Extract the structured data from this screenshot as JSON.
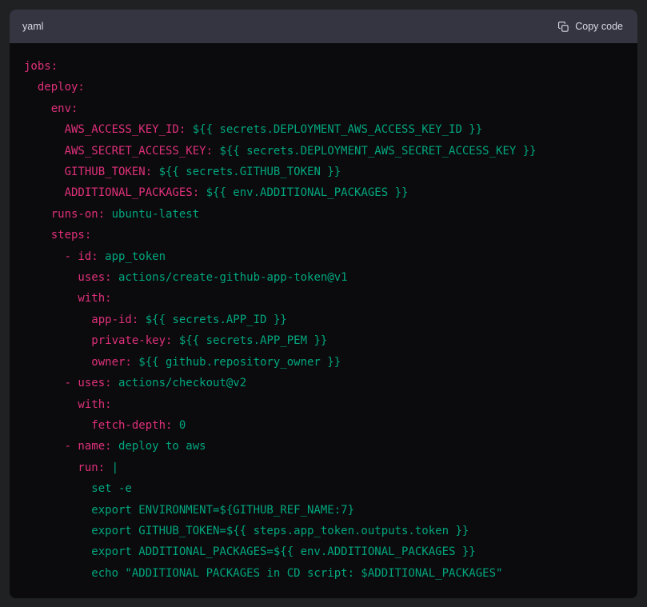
{
  "page": {
    "background": "#202123"
  },
  "code_block": {
    "header": {
      "language": "yaml",
      "copy_label": "Copy code",
      "background": "#343541",
      "text_color": "#d9d9e3"
    },
    "colors": {
      "key": "#df3079",
      "string": "#00a67d",
      "body_bg": "#0b0b0e"
    },
    "lines": [
      [
        [
          "key",
          "jobs:"
        ]
      ],
      [
        [
          "key",
          "  deploy:"
        ]
      ],
      [
        [
          "key",
          "    env:"
        ]
      ],
      [
        [
          "key",
          "      AWS_ACCESS_KEY_ID:"
        ],
        [
          "str",
          " ${{ secrets.DEPLOYMENT_AWS_ACCESS_KEY_ID }}"
        ]
      ],
      [
        [
          "key",
          "      AWS_SECRET_ACCESS_KEY:"
        ],
        [
          "str",
          " ${{ secrets.DEPLOYMENT_AWS_SECRET_ACCESS_KEY }}"
        ]
      ],
      [
        [
          "key",
          "      GITHUB_TOKEN:"
        ],
        [
          "str",
          " ${{ secrets.GITHUB_TOKEN }}"
        ]
      ],
      [
        [
          "key",
          "      ADDITIONAL_PACKAGES:"
        ],
        [
          "str",
          " ${{ env.ADDITIONAL_PACKAGES }}"
        ]
      ],
      [
        [
          "key",
          "    runs-on:"
        ],
        [
          "str",
          " ubuntu-latest"
        ]
      ],
      [
        [
          "key",
          "    steps:"
        ]
      ],
      [
        [
          "key",
          "      - id:"
        ],
        [
          "str",
          " app_token"
        ]
      ],
      [
        [
          "key",
          "        uses:"
        ],
        [
          "str",
          " actions/create-github-app-token@v1"
        ]
      ],
      [
        [
          "key",
          "        with:"
        ]
      ],
      [
        [
          "key",
          "          app-id:"
        ],
        [
          "str",
          " ${{ secrets.APP_ID }}"
        ]
      ],
      [
        [
          "key",
          "          private-key:"
        ],
        [
          "str",
          " ${{ secrets.APP_PEM }}"
        ]
      ],
      [
        [
          "key",
          "          owner:"
        ],
        [
          "str",
          " ${{ github.repository_owner }}"
        ]
      ],
      [
        [
          "key",
          "      - uses:"
        ],
        [
          "str",
          " actions/checkout@v2"
        ]
      ],
      [
        [
          "key",
          "        with:"
        ]
      ],
      [
        [
          "key",
          "          fetch-depth:"
        ],
        [
          "str",
          " 0"
        ]
      ],
      [
        [
          "key",
          "      - name:"
        ],
        [
          "str",
          " deploy to aws"
        ]
      ],
      [
        [
          "key",
          "        run:"
        ],
        [
          "str",
          " |"
        ]
      ],
      [
        [
          "str",
          "          set -e"
        ]
      ],
      [
        [
          "str",
          "          export ENVIRONMENT=${GITHUB_REF_NAME:7}"
        ]
      ],
      [
        [
          "str",
          "          export GITHUB_TOKEN=${{ steps.app_token.outputs.token }}"
        ]
      ],
      [
        [
          "str",
          "          export ADDITIONAL_PACKAGES=${{ env.ADDITIONAL_PACKAGES }}"
        ]
      ],
      [
        [
          "str",
          "          echo \"ADDITIONAL PACKAGES in CD script: $ADDITIONAL_PACKAGES\""
        ]
      ]
    ]
  }
}
